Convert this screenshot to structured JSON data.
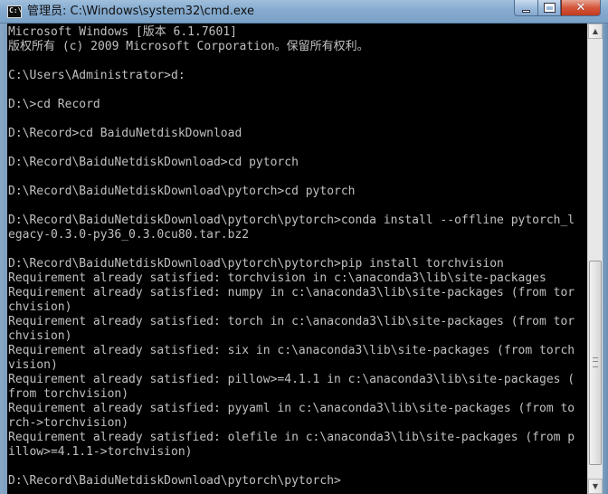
{
  "window": {
    "title": "管理员: C:\\Windows\\system32\\cmd.exe",
    "icon_label": "C:\\",
    "icon": "cmd-icon",
    "buttons": {
      "minimize": "minimize-icon",
      "maximize": "maximize-icon",
      "close": "close-icon",
      "close_glyph": "✕"
    }
  },
  "console": {
    "background": "#000000",
    "foreground": "#c0c0c0",
    "lines": [
      "Microsoft Windows [版本 6.1.7601]",
      "版权所有 (c) 2009 Microsoft Corporation。保留所有权利。",
      "",
      "C:\\Users\\Administrator>d:",
      "",
      "D:\\>cd Record",
      "",
      "D:\\Record>cd BaiduNetdiskDownload",
      "",
      "D:\\Record\\BaiduNetdiskDownload>cd pytorch",
      "",
      "D:\\Record\\BaiduNetdiskDownload\\pytorch>cd pytorch",
      "",
      "D:\\Record\\BaiduNetdiskDownload\\pytorch\\pytorch>conda install --offline pytorch_l",
      "egacy-0.3.0-py36_0.3.0cu80.tar.bz2",
      "",
      "D:\\Record\\BaiduNetdiskDownload\\pytorch\\pytorch>pip install torchvision",
      "Requirement already satisfied: torchvision in c:\\anaconda3\\lib\\site-packages",
      "Requirement already satisfied: numpy in c:\\anaconda3\\lib\\site-packages (from tor",
      "chvision)",
      "Requirement already satisfied: torch in c:\\anaconda3\\lib\\site-packages (from tor",
      "chvision)",
      "Requirement already satisfied: six in c:\\anaconda3\\lib\\site-packages (from torch",
      "vision)",
      "Requirement already satisfied: pillow>=4.1.1 in c:\\anaconda3\\lib\\site-packages (",
      "from torchvision)",
      "Requirement already satisfied: pyyaml in c:\\anaconda3\\lib\\site-packages (from to",
      "rch->torchvision)",
      "Requirement already satisfied: olefile in c:\\anaconda3\\lib\\site-packages (from p",
      "illow>=4.1.1->torchvision)",
      "",
      "D:\\Record\\BaiduNetdiskDownload\\pytorch\\pytorch>"
    ]
  },
  "scrollbar": {
    "up_glyph": "▲",
    "down_glyph": "▼"
  }
}
